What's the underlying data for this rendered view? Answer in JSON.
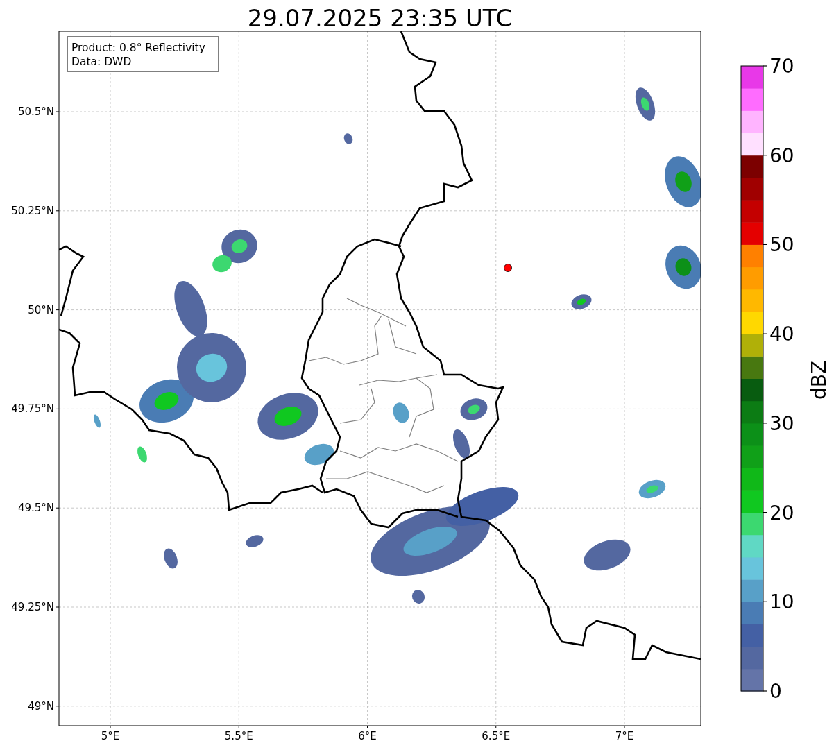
{
  "title": "29.07.2025 23:35 UTC",
  "annotation": {
    "lines": [
      "Product: 0.8° Reflectivity",
      "Data: DWD"
    ]
  },
  "map": {
    "x_tick_labels": [
      "5°E",
      "5.5°E",
      "6°E",
      "6.5°E",
      "7°E"
    ],
    "y_tick_labels": [
      "50.5°N",
      "50.25°N",
      "50°N",
      "49.75°N",
      "49.5°N",
      "49.25°N",
      "49°N"
    ]
  },
  "colorbar": {
    "label": "dBZ",
    "tick_labels": [
      "70",
      "60",
      "50",
      "40",
      "30",
      "20",
      "10",
      "0"
    ],
    "segments": [
      {
        "color": "#6474a8"
      },
      {
        "color": "#5468a0"
      },
      {
        "color": "#4460a4"
      },
      {
        "color": "#4a7cb4"
      },
      {
        "color": "#58a0c8"
      },
      {
        "color": "#68c4dc"
      },
      {
        "color": "#60d8c4"
      },
      {
        "color": "#3cd870"
      },
      {
        "color": "#10c820"
      },
      {
        "color": "#10b818"
      },
      {
        "color": "#10a018"
      },
      {
        "color": "#0c9018"
      },
      {
        "color": "#0c7c14"
      },
      {
        "color": "#085c10"
      },
      {
        "color": "#487810"
      },
      {
        "color": "#b0b008"
      },
      {
        "color": "#ffd800"
      },
      {
        "color": "#ffb800"
      },
      {
        "color": "#ff9c00"
      },
      {
        "color": "#ff8000"
      },
      {
        "color": "#e40000"
      },
      {
        "color": "#c40000"
      },
      {
        "color": "#a00000"
      },
      {
        "color": "#7c0000"
      },
      {
        "color": "#ffe0ff"
      },
      {
        "color": "#ffb4ff"
      },
      {
        "color": "#ff6cff"
      },
      {
        "color": "#e838e8"
      }
    ]
  }
}
